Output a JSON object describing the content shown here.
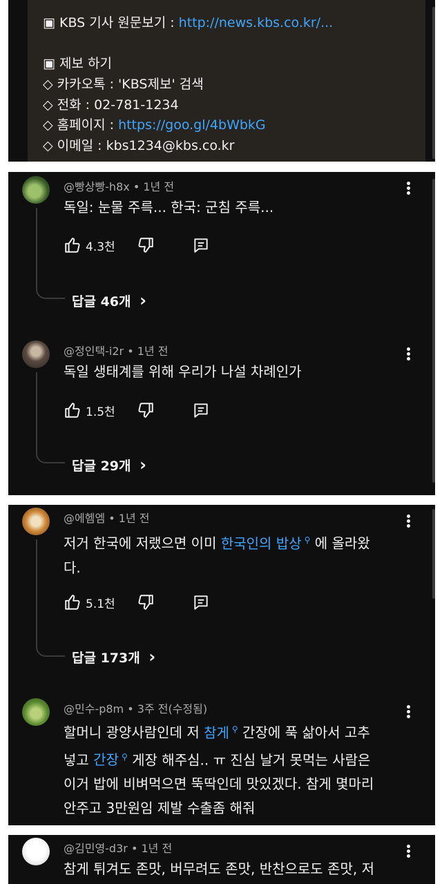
{
  "description": {
    "lines": [
      "▣ KBS 기사 원문보기 : ",
      "",
      "▣ 제보 하기",
      "◇ 카카오톡 : 'KBS제보' 검색",
      "◇ 전화 : 02-781-1234",
      "◇ 홈페이지 : ",
      "◇ 이메일 : kbs1234@kbs.co.kr"
    ],
    "article_link": "http://news.kbs.co.kr/...",
    "homepage_link": "https://goo.gl/4bWbkG"
  },
  "comments": [
    {
      "author": "@빵상빵-h8x",
      "time": "1년 전",
      "text": "독일: 눈물 주륵...  한국: 군침 주륵...",
      "likes": "4.3천",
      "replies": "답글 46개"
    },
    {
      "author": "@정인택-i2r",
      "time": "1년 전",
      "text": "독일 생태계를 위해 우리가 나설 차례인가",
      "likes": "1.5천",
      "replies": "답글 29개"
    },
    {
      "author": "@에헴엠",
      "time": "1년 전",
      "text_part1": "저거 한국에 저랬으면 이미 ",
      "text_link": "한국인의 밥상",
      "text_part2": " 에 올라왔",
      "text_line2": "다.",
      "likes": "5.1천",
      "replies": "답글 173개"
    },
    {
      "author": "@민수-p8m",
      "time": "3주 전(수정됨)",
      "line1_a": "할머니 광양사람인데 저 ",
      "line1_link": "참게",
      "line1_b": " 간장에 푹 삶아서 고추",
      "line2_a": "넣고 ",
      "line2_link": "간장",
      "line2_b": " 게장 해주심.. ㅠ 진심 날거 못먹는 사람은",
      "line3": "이거 밥에 비벼먹으면 뚝딱인데 맛있겠다. 참게 몇마리",
      "line4": "안주고 3만원임 제발 수출좀 해줘"
    },
    {
      "author": "@김민영-d3r",
      "time": "1년 전",
      "text": "참게 튀겨도 존맛, 버무려도 존맛, 반찬으로도 존맛, 저"
    }
  ],
  "meta_separator": "•",
  "reply_chevron": "›"
}
